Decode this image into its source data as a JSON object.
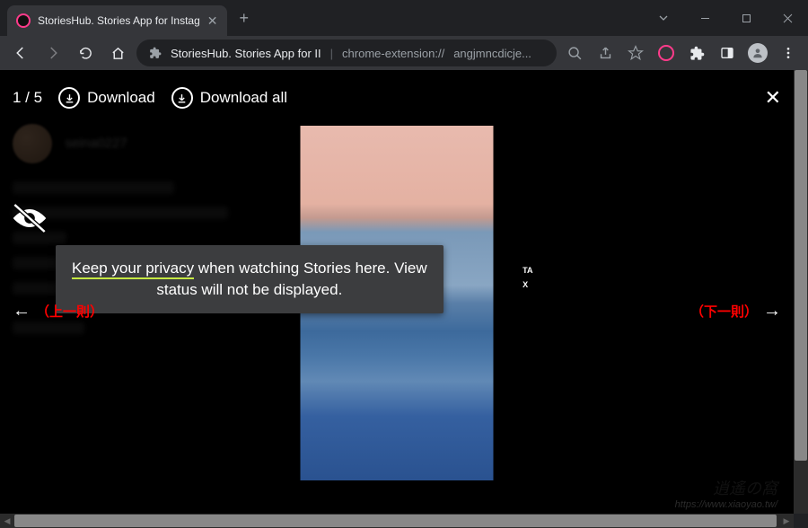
{
  "tab": {
    "title": "StoriesHub. Stories App for Instag"
  },
  "url": {
    "title": "StoriesHub. Stories App for II",
    "protocol": "chrome-extension://",
    "path": "angjmncdicje..."
  },
  "viewer": {
    "counter": "1 / 5",
    "download": "Download",
    "download_all": "Download all"
  },
  "bg": {
    "username": "seina0227"
  },
  "tooltip": {
    "highlight": "Keep your privacy",
    "rest1": " when watching Stories here. View",
    "rest2": "status will not be displayed."
  },
  "nav": {
    "prev": "（上一則）",
    "next": "（下一則）"
  },
  "story_badge": {
    "t1": "TA",
    "t2": "X"
  },
  "watermark": {
    "logo": "逍遙の窩",
    "url": "https://www.xiaoyao.tw/"
  }
}
